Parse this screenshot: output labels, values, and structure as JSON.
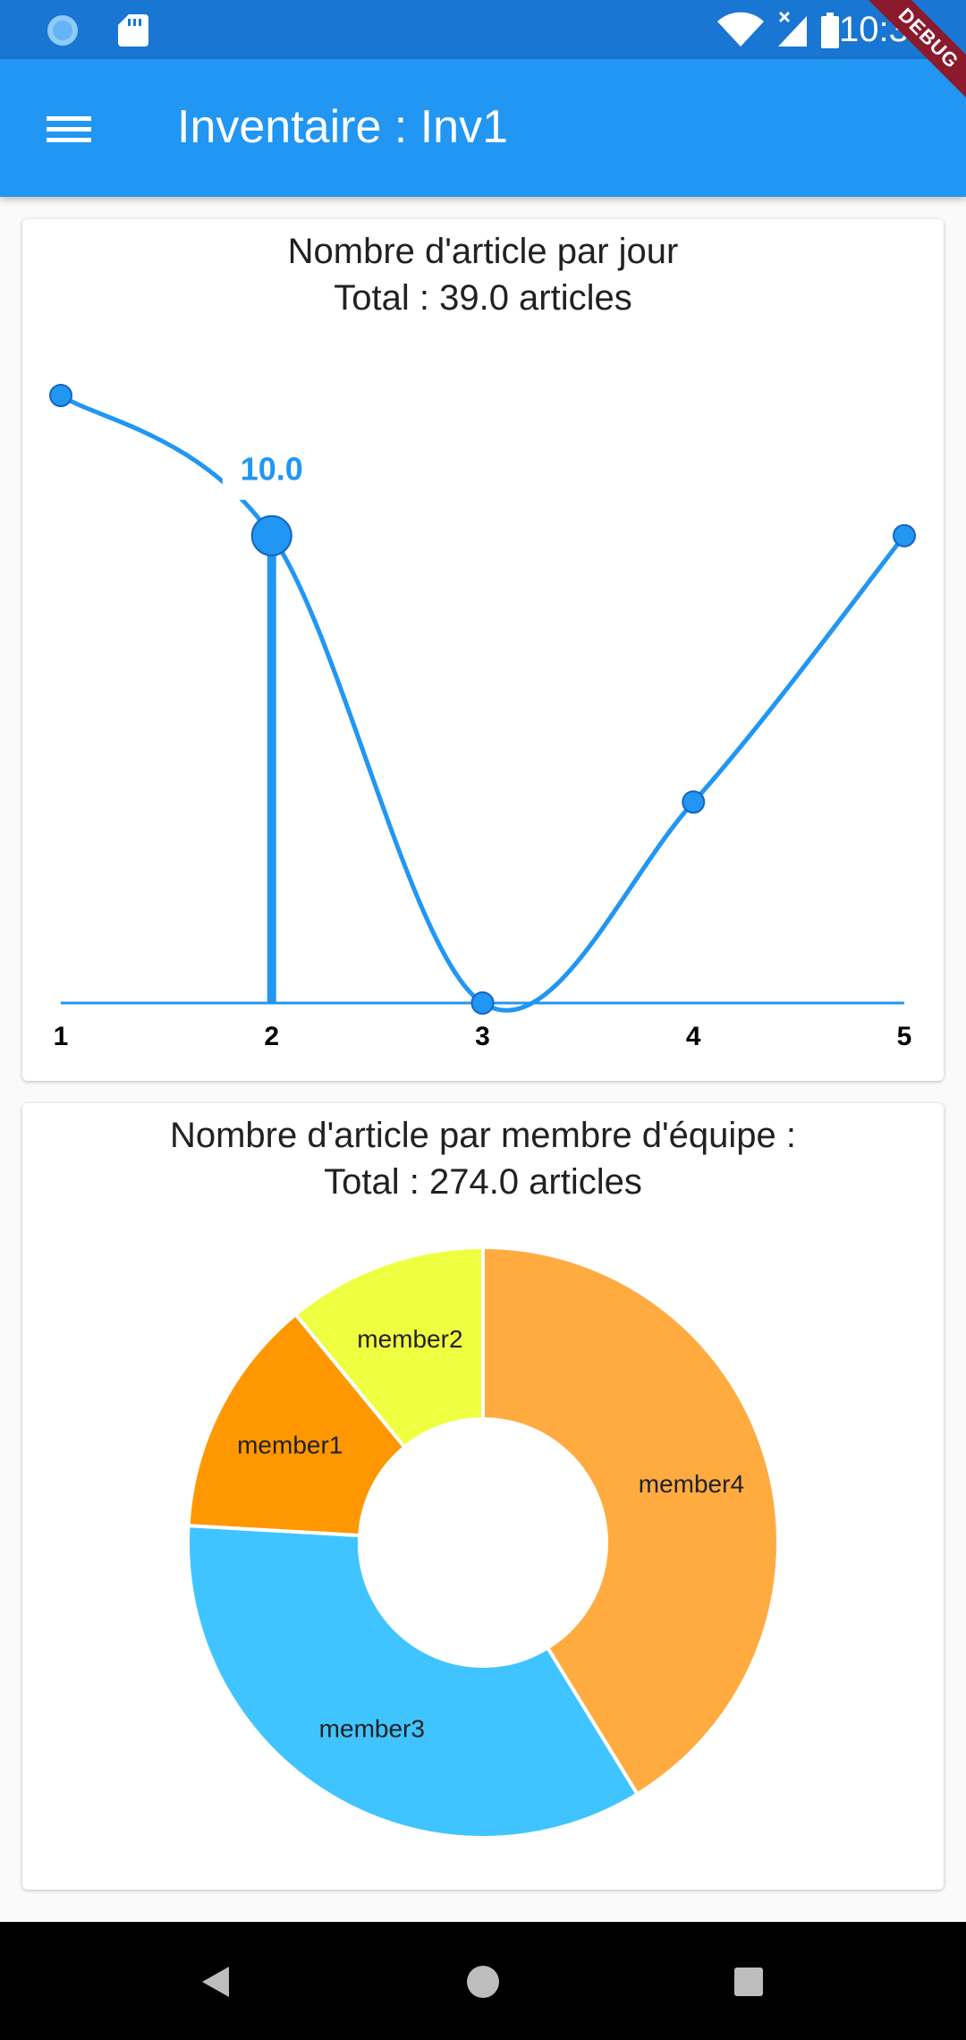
{
  "status_bar": {
    "time": "10:32",
    "icons": [
      "sync-icon",
      "sd-card-icon",
      "wifi-icon",
      "signal-icon",
      "battery-icon"
    ]
  },
  "debug_banner": "DEBUG",
  "app_bar": {
    "title": "Inventaire : Inv1",
    "menu_icon": "hamburger-menu-icon"
  },
  "colors": {
    "status_bar": "#1976d2",
    "app_bar": "#2196f3",
    "line": "#2196f3",
    "member1": "#ff9800",
    "member2": "#eeff41",
    "member3": "#40c4ff",
    "member4": "#ffab40"
  },
  "line_card": {
    "title": "Nombre d'article par jour",
    "total": "Total : 39.0 articles"
  },
  "pie_card": {
    "title": "Nombre d'article par membre d'équipe :",
    "total": "Total : 274.0 articles"
  },
  "chart_data": [
    {
      "type": "line",
      "x": [
        1,
        2,
        3,
        4,
        5
      ],
      "values": [
        13.0,
        10.0,
        0.0,
        4.3,
        10.0
      ],
      "xlabel": "",
      "ylabel": "",
      "ylim": [
        0,
        13
      ],
      "highlight": {
        "x": 2,
        "label": "10.0"
      },
      "tick_labels": [
        "1",
        "2",
        "3",
        "4",
        "5"
      ]
    },
    {
      "type": "pie",
      "donut": true,
      "categories": [
        "member4",
        "member3",
        "member1",
        "member2"
      ],
      "values": [
        113,
        95,
        36,
        30
      ],
      "colors": [
        "#ffab40",
        "#40c4ff",
        "#ff9800",
        "#eeff41"
      ]
    }
  ],
  "nav_bar": {
    "icons": [
      "back-icon",
      "home-icon",
      "recents-icon"
    ]
  }
}
